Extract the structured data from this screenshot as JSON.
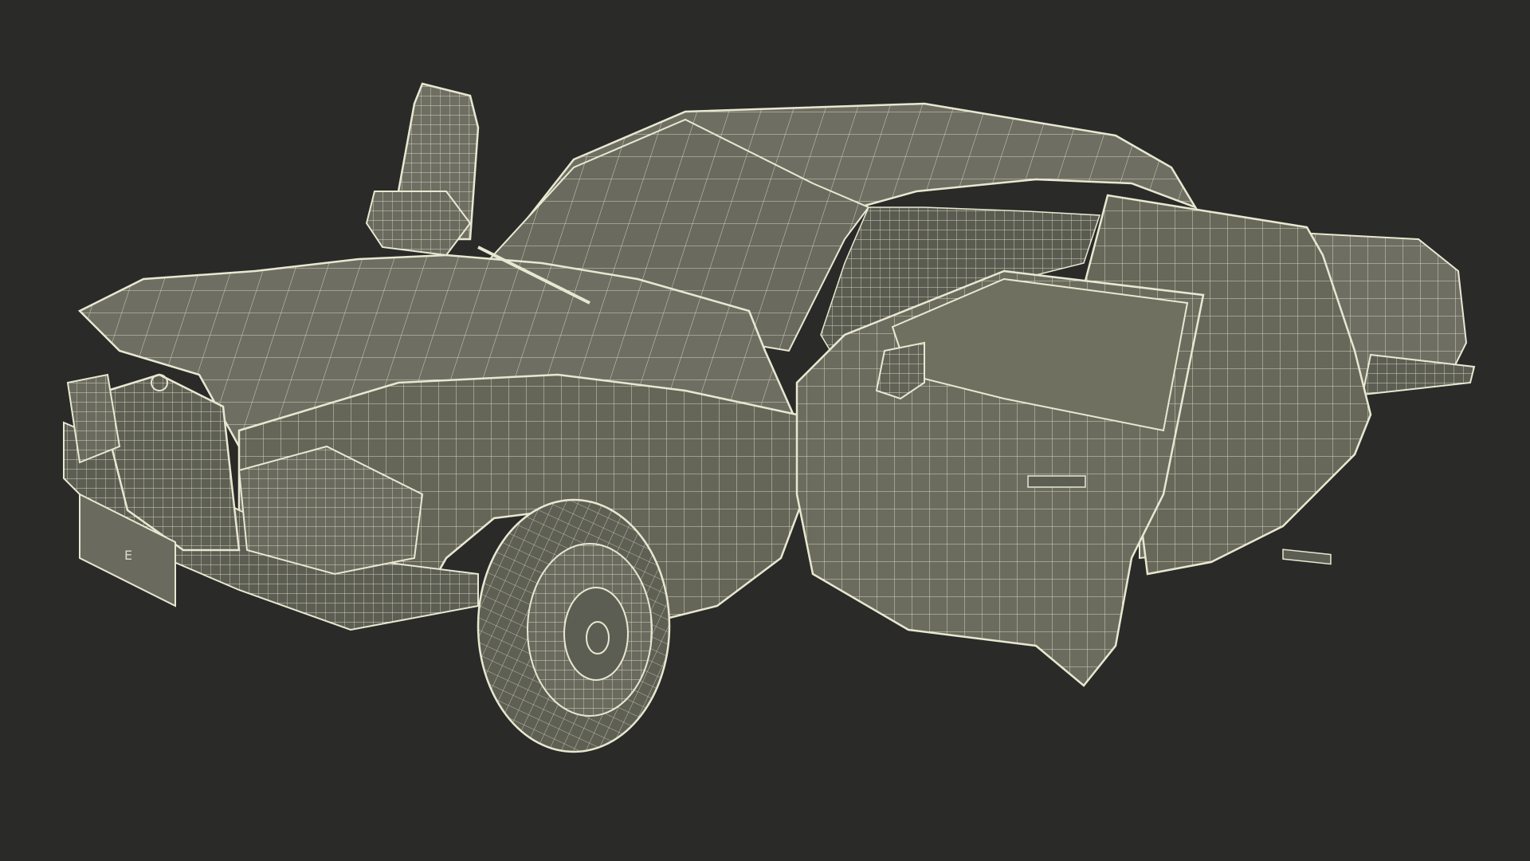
{
  "scene": {
    "subject": "car-wireframe-model",
    "background_color": "#2a2a28",
    "surface_color": "#6e6f62",
    "surface_shade_color": "#5d5e53",
    "wire_color": "#e8e8d2",
    "doors_open": [
      "front-left",
      "front-right",
      "rear-right",
      "bonnet-mirror"
    ]
  },
  "plate": {
    "text": "E"
  }
}
